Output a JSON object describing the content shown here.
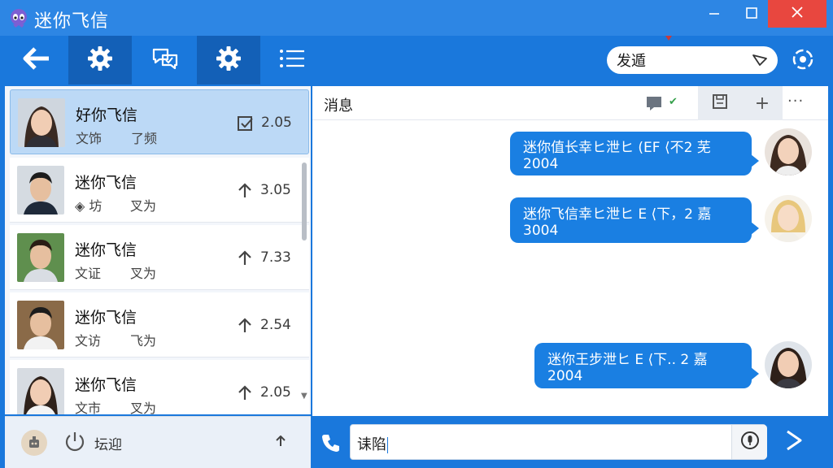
{
  "window": {
    "title": "迷你飞信",
    "logo_icon": "alien-logo-icon",
    "controls": [
      "minimize-icon",
      "maximize-icon",
      "close-icon"
    ]
  },
  "toolbar": {
    "items": [
      {
        "name": "back",
        "icon": "arrow-left-icon",
        "active": false
      },
      {
        "name": "settings",
        "icon": "gear-icon",
        "active": true
      },
      {
        "name": "chat",
        "icon": "chat-bubbles-icon",
        "active": false
      },
      {
        "name": "settings-2",
        "icon": "gear-icon",
        "active": true
      },
      {
        "name": "list",
        "icon": "list-icon",
        "active": false
      }
    ],
    "search": {
      "value": "发遁",
      "send_icon": "send-icon"
    },
    "sync_icon": "sync-icon"
  },
  "contacts": [
    {
      "name": "好你飞信",
      "sub": "文饰",
      "sub2": "了频",
      "value": "2.05",
      "icon": "checkbox-icon",
      "selected": true
    },
    {
      "name": "迷你飞信",
      "sub": "◈ 坊",
      "sub2": "叉为",
      "value": "3.05",
      "icon": "arrow-up-icon",
      "selected": false
    },
    {
      "name": "迷你飞信",
      "sub": "文证",
      "sub2": "叉为",
      "value": "7.33",
      "icon": "arrow-up-icon",
      "selected": false
    },
    {
      "name": "迷你飞信",
      "sub": "文访",
      "sub2": "飞为",
      "value": "2.54",
      "icon": "arrow-up-icon",
      "selected": false
    },
    {
      "name": "迷你飞信",
      "sub": "文市",
      "sub2": "叉为",
      "value": "2.05",
      "icon": "arrow-up-icon",
      "selected": false
    }
  ],
  "left_footer": {
    "label": "坛迎",
    "avatar_icon": "robot-avatar-icon",
    "power_icon": "power-icon",
    "up_icon": "arrow-up-icon"
  },
  "chat": {
    "title": "消息",
    "header_icons": [
      "comment-icon",
      "check-icon",
      "save-icon",
      "plus-icon",
      "more-icon"
    ],
    "add_label": "+",
    "more_label": "···",
    "check_label": "✔",
    "messages": [
      {
        "text": "迷你值长幸ヒ泄ヒ (EF ⟨不2 芜2004",
        "avatar": "woman-avatar"
      },
      {
        "text": "迷你飞信幸ヒ泄ヒ E ⟨下，2 嘉3004",
        "avatar": "blonde-avatar"
      },
      {
        "text": "迷你王步泄ヒ E ⟨下.. 2 嘉2004",
        "avatar": "woman-avatar-2"
      }
    ]
  },
  "input": {
    "value": "诔陷",
    "phone_icon": "phone-icon",
    "mic_icon": "microphone-icon",
    "send_icon": "send-arrow-icon"
  },
  "colors": {
    "primary": "#1a78dc",
    "title_bar": "#2d86e4",
    "active_tab": "#1360b7",
    "bubble": "#1a7fe2",
    "selected_row": "#bcd9f6",
    "close": "#e8473f"
  }
}
